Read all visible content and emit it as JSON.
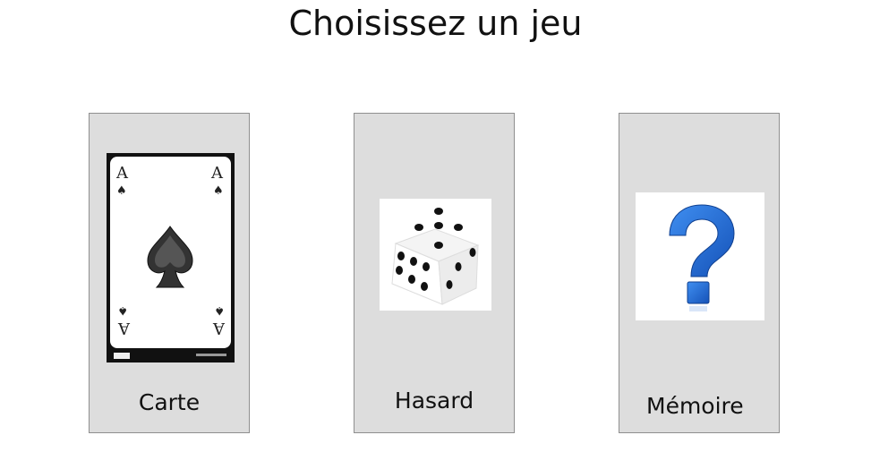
{
  "page": {
    "title": "Choisissez un jeu"
  },
  "games": [
    {
      "label": "Carte",
      "icon": "ace-of-spades-card-icon"
    },
    {
      "label": "Hasard",
      "icon": "dice-icon"
    },
    {
      "label": "Mémoire",
      "icon": "question-mark-icon"
    }
  ],
  "colors": {
    "card_bg": "#dddddd",
    "card_border": "#8f8f8f",
    "question_blue": "#1f6ed4"
  }
}
